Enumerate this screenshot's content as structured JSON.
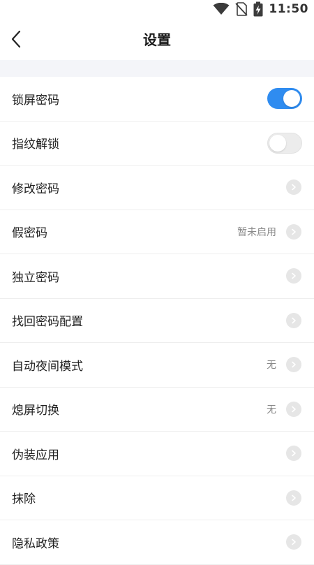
{
  "status_bar": {
    "time": "11:50",
    "icons": [
      "wifi-icon",
      "no-sim-icon",
      "battery-charging-icon"
    ]
  },
  "header": {
    "title": "设置",
    "back_icon": "chevron-left-icon"
  },
  "colors": {
    "accent": "#2f8cf0",
    "band": "#f4f5f9",
    "divider": "#eeeeee"
  },
  "settings": {
    "lock_screen_password": {
      "label": "锁屏密码",
      "toggle_on": true
    },
    "fingerprint_unlock": {
      "label": "指纹解锁",
      "toggle_on": false
    },
    "change_password": {
      "label": "修改密码"
    },
    "fake_password": {
      "label": "假密码",
      "value": "暂未启用"
    },
    "independent_password": {
      "label": "独立密码"
    },
    "password_recovery": {
      "label": "找回密码配置"
    },
    "auto_night_mode": {
      "label": "自动夜间模式",
      "value": "无"
    },
    "screen_off_switch": {
      "label": "熄屏切换",
      "value": "无"
    },
    "disguise_app": {
      "label": "伪装应用"
    },
    "erase": {
      "label": "抹除"
    },
    "privacy_policy": {
      "label": "隐私政策"
    }
  }
}
